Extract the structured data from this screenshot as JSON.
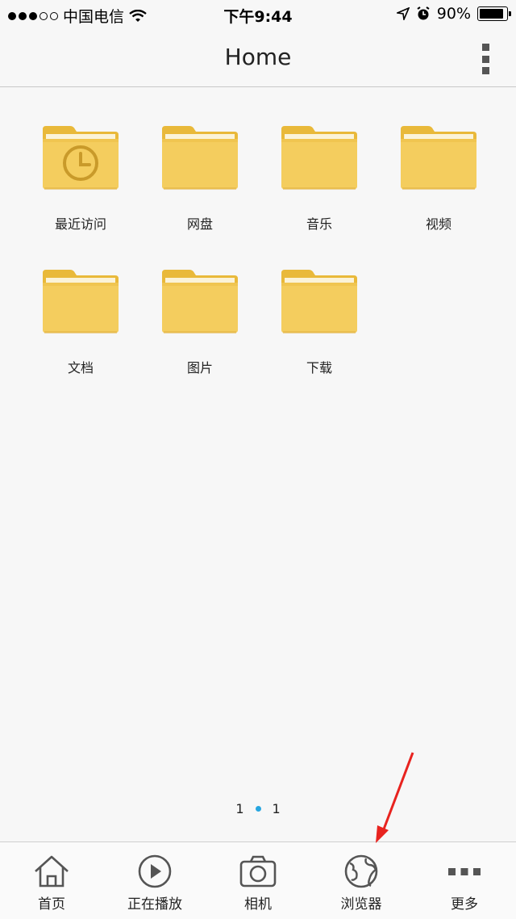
{
  "status_bar": {
    "carrier": "中国电信",
    "time": "下午9:44",
    "battery": "90%",
    "battery_level": 0.9
  },
  "header": {
    "title": "Home",
    "menu_icon": "kebab-vertical-icon"
  },
  "folders": [
    {
      "label": "最近访问",
      "icon": "clock-folder-icon"
    },
    {
      "label": "网盘",
      "icon": "folder-icon"
    },
    {
      "label": "音乐",
      "icon": "folder-icon"
    },
    {
      "label": "视频",
      "icon": "folder-icon"
    },
    {
      "label": "文档",
      "icon": "folder-icon"
    },
    {
      "label": "图片",
      "icon": "folder-icon"
    },
    {
      "label": "下载",
      "icon": "folder-icon"
    }
  ],
  "pager": {
    "current": "1",
    "total": "1"
  },
  "tabs": [
    {
      "label": "首页",
      "icon": "home-icon"
    },
    {
      "label": "正在播放",
      "icon": "play-icon"
    },
    {
      "label": "相机",
      "icon": "camera-icon"
    },
    {
      "label": "浏览器",
      "icon": "globe-icon"
    },
    {
      "label": "更多",
      "icon": "more-icon"
    }
  ],
  "colors": {
    "folder_top": "#e9b93a",
    "folder_body": "#f4cd5e",
    "pager_dot": "#27a6e0",
    "annotation_arrow": "#e8231f"
  }
}
